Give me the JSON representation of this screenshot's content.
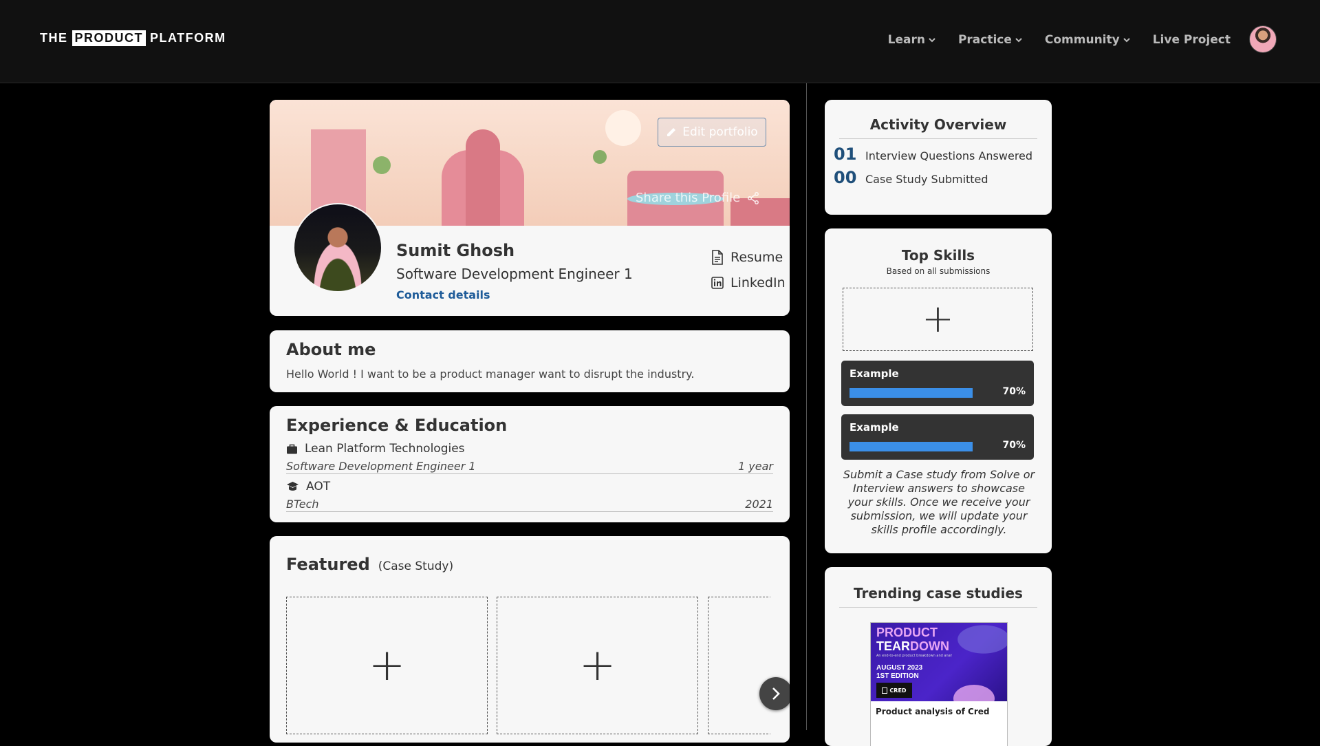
{
  "brand": {
    "pre": "THE",
    "boxed": "PRODUCT",
    "post": "PLATFORM"
  },
  "nav": {
    "items": [
      {
        "label": "Learn",
        "dropdown": true
      },
      {
        "label": "Practice",
        "dropdown": true
      },
      {
        "label": "Community",
        "dropdown": true
      },
      {
        "label": "Live Project",
        "dropdown": false
      }
    ]
  },
  "profile": {
    "edit_label": "Edit portfolio",
    "share_label": "Share this Profile",
    "name": "Sumit Ghosh",
    "role": "Software Development Engineer 1",
    "contact_label": "Contact details",
    "resume_label": "Resume",
    "linkedin_label": "LinkedIn"
  },
  "about": {
    "title": "About me",
    "text": "Hello World ! I want to be a product manager want to disrupt the industry."
  },
  "experience": {
    "title": "Experience & Education",
    "items": [
      {
        "icon": "briefcase-icon",
        "org": "Lean Platform Technologies",
        "detail": "Software Development Engineer 1",
        "meta": "1 year"
      },
      {
        "icon": "graduation-cap-icon",
        "org": "AOT",
        "detail": "BTech",
        "meta": "2021"
      }
    ]
  },
  "featured": {
    "title": "Featured",
    "subtitle": "(Case Study)"
  },
  "activity": {
    "title": "Activity Overview",
    "rows": [
      {
        "count": "01",
        "label": "Interview Questions Answered"
      },
      {
        "count": "00",
        "label": "Case Study Submitted"
      }
    ]
  },
  "skills": {
    "title": "Top Skills",
    "subtitle": "Based on all submissions",
    "items": [
      {
        "name": "Example",
        "percent_label": "70%",
        "level": 0.7
      },
      {
        "name": "Example",
        "percent_label": "70%",
        "level": 0.7
      }
    ],
    "note": "Submit a Case study from Solve or Interview answers to showcase your skills. Once we receive your submission, we will update your skills profile accordingly."
  },
  "trending": {
    "title": "Trending case studies",
    "card": {
      "line1": "PRODUCT",
      "line2a": "TEAR",
      "line2b": "DOWN",
      "tagline": "An end-to-end product breakdown and analysis",
      "edition1": "AUGUST 2023",
      "edition2": "1ST EDITION",
      "badge": "CRED",
      "caption": "Product analysis of Cred"
    }
  },
  "colors": {
    "accent": "#1f5c99",
    "skill_bar": "#3b8fe8",
    "navbar": "#111111",
    "card": "#f7f7f7"
  }
}
